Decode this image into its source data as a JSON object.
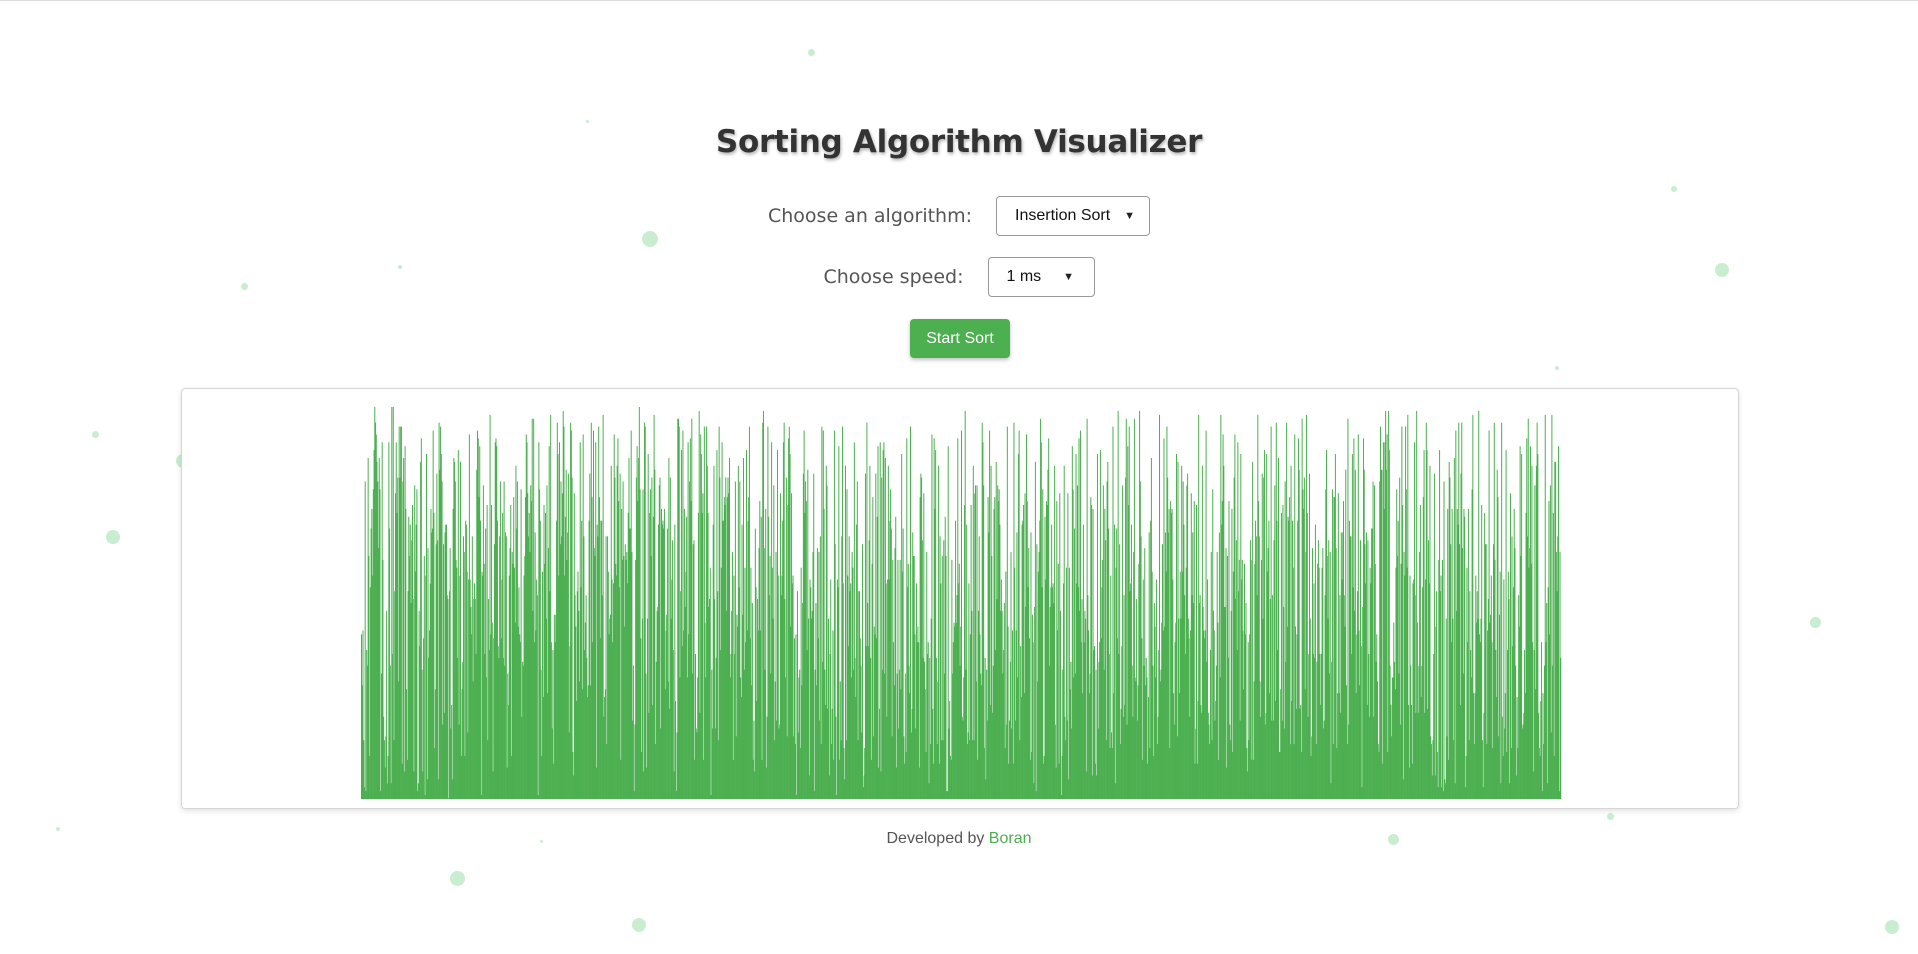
{
  "page": {
    "title": "Sorting Algorithm Visualizer",
    "algorithm_label": "Choose an algorithm:",
    "algorithm_selected": "Insertion Sort",
    "speed_label": "Choose speed:",
    "speed_selected": "1 ms",
    "start_button": "Start Sort",
    "footer_prefix": "Developed by",
    "footer_author": "Boran"
  },
  "colors": {
    "accent": "#4caf50",
    "bar": "#4caf50",
    "dot": "#c9edcf"
  },
  "chart_data": {
    "type": "bar",
    "ylim": [
      0,
      100
    ],
    "values": [
      42,
      29,
      43,
      15,
      3,
      81,
      2,
      38,
      34,
      87,
      62,
      11,
      54,
      69,
      74,
      57,
      79,
      89,
      100,
      96,
      93,
      86,
      81,
      64,
      87,
      79,
      2,
      32,
      91,
      61,
      21,
      15,
      8,
      16,
      48,
      4,
      11,
      91,
      69,
      34,
      4,
      100,
      37,
      100,
      15,
      53,
      78,
      91,
      73,
      82,
      30,
      95,
      82,
      95,
      95,
      9,
      81,
      87,
      7,
      90,
      74,
      28,
      10,
      53,
      72,
      62,
      70,
      50,
      66,
      75,
      51,
      7,
      80,
      58,
      70,
      79,
      2,
      4,
      48,
      39,
      86,
      92,
      33,
      7,
      41,
      62,
      1,
      57,
      88,
      5,
      64,
      36,
      43,
      55,
      74,
      68,
      69,
      94,
      73,
      13,
      28,
      65,
      83,
      66,
      5,
      96,
      84,
      95,
      88,
      81,
      19,
      65,
      22,
      68,
      70,
      70,
      52,
      51,
      0,
      53,
      64,
      18,
      24,
      5,
      74,
      87,
      86,
      81,
      61,
      59,
      36,
      89,
      19,
      57,
      86,
      11,
      28,
      35,
      67,
      63,
      11,
      71,
      70,
      58,
      17,
      56,
      93,
      56,
      49,
      42,
      67,
      30,
      51,
      55,
      51,
      37,
      84,
      94,
      92,
      77,
      90,
      71,
      1,
      58,
      57,
      80,
      60,
      37,
      69,
      31,
      75,
      15,
      51,
      38,
      98,
      42,
      75,
      45,
      7,
      41,
      65,
      91,
      92,
      90,
      71,
      39,
      36,
      67,
      81,
      41,
      56,
      73,
      36,
      81,
      34,
      68,
      67,
      8,
      32,
      24,
      57,
      64,
      75,
      11,
      63,
      60,
      77,
      59,
      45,
      85,
      69,
      81,
      44,
      54,
      42,
      40,
      79,
      21,
      35,
      34,
      57,
      62,
      77,
      93,
      91,
      78,
      67,
      73,
      63,
      80,
      76,
      97,
      48,
      97,
      40,
      68,
      43,
      56,
      52,
      1,
      91,
      79,
      71,
      33,
      11,
      58,
      26,
      75,
      60,
      73,
      46,
      80,
      27,
      64,
      90,
      53,
      98,
      40,
      18,
      38,
      9,
      47,
      40,
      47,
      71,
      96,
      88,
      57,
      91,
      65,
      81,
      67,
      78,
      99,
      95,
      57,
      72,
      84,
      61,
      68,
      83,
      17,
      39,
      96,
      94,
      82,
      12,
      6,
      78,
      52,
      44,
      25,
      53,
      58,
      48,
      30,
      91,
      54,
      71,
      28,
      93,
      67,
      38,
      45,
      52,
      36,
      26,
      29,
      71,
      83,
      29,
      96,
      77,
      40,
      94,
      64,
      62,
      91,
      8,
      70,
      67,
      95,
      77,
      41,
      71,
      71,
      52,
      98,
      21,
      26,
      28,
      67,
      14,
      67,
      58,
      42,
      46,
      47,
      85,
      56,
      40,
      55,
      93,
      82,
      60,
      57,
      85,
      92,
      76,
      54,
      83,
      10,
      74,
      61,
      81,
      62,
      44,
      65,
      61,
      63,
      55,
      73,
      87,
      69,
      69,
      94,
      63,
      20,
      34,
      2,
      19,
      61,
      82,
      90,
      76,
      87,
      100,
      79,
      41,
      12,
      46,
      79,
      7,
      96,
      95,
      32,
      8,
      46,
      88,
      22,
      73,
      79,
      62,
      82,
      24,
      72,
      98,
      84,
      14,
      35,
      48,
      49,
      70,
      80,
      82,
      18,
      74,
      70,
      71,
      69,
      74,
      28,
      43,
      47,
      69,
      30,
      87,
      23,
      82,
      46,
      56,
      66,
      38,
      7,
      70,
      25,
      2,
      17,
      97,
      97,
      95,
      31,
      53,
      89,
      39,
      94,
      43,
      74,
      49,
      58,
      72,
      31,
      91,
      42,
      81,
      92,
      76,
      97,
      32,
      65,
      66,
      10,
      37,
      18,
      17,
      31,
      73,
      99,
      22,
      93,
      88,
      73,
      78,
      10,
      95,
      45,
      31,
      95,
      85,
      73,
      49,
      51,
      59,
      1,
      33,
      18,
      70,
      85,
      51,
      18,
      36,
      89,
      53,
      15,
      95,
      82,
      38,
      59,
      91,
      71,
      71,
      77,
      75,
      82,
      48,
      77,
      82,
      78,
      87,
      31,
      37,
      48,
      63,
      10,
      57,
      37,
      81,
      16,
      47,
      44,
      85,
      54,
      81,
      31,
      26,
      70,
      47,
      87,
      33,
      59,
      40,
      89,
      43,
      71,
      77,
      95,
      41,
      59,
      29,
      50,
      10,
      20,
      7,
      69,
      54,
      25,
      51,
      43,
      64,
      76,
      43,
      72,
      10,
      96,
      99,
      64,
      33,
      74,
      8,
      21,
      95,
      72,
      52,
      62,
      32,
      91,
      59,
      46,
      80,
      15,
      30,
      63,
      20,
      89,
      57,
      18,
      19,
      78,
      52,
      57,
      71,
      91,
      96,
      51,
      31,
      82,
      16,
      75,
      92,
      95,
      88,
      44,
      78,
      55,
      57,
      16,
      41,
      14,
      42,
      1,
      53,
      17,
      31,
      33,
      13,
      59,
      29,
      50,
      83,
      94,
      73,
      81,
      76,
      38,
      84,
      46,
      6,
      56,
      54,
      46,
      48,
      63,
      83,
      2,
      33,
      50,
      29,
      64,
      41,
      63,
      20,
      67,
      14,
      95,
      35,
      94,
      74,
      33,
      24,
      85,
      80,
      23,
      46,
      6,
      37,
      56,
      14,
      23,
      43,
      10,
      94,
      65,
      21,
      1,
      56,
      54,
      90,
      10,
      30,
      15,
      67,
      95,
      55,
      13,
      5,
      85,
      15,
      79,
      57,
      39,
      67,
      53,
      55,
      31,
      63,
      59,
      33,
      91,
      36,
      26,
      70,
      81,
      15,
      53,
      53,
      41,
      34,
      17,
      65,
      3,
      6,
      13,
      83,
      39,
      96,
      50,
      39,
      66,
      85,
      36,
      10,
      60,
      77,
      16,
      44,
      42,
      83,
      41,
      72,
      90,
      8,
      23,
      91,
      7,
      82,
      33,
      89,
      91,
      32,
      87,
      55,
      21,
      56,
      85,
      56,
      71,
      79,
      69,
      16,
      61,
      40,
      29,
      64,
      72,
      8,
      32,
      61,
      18,
      33,
      61,
      28,
      88,
      58,
      69,
      16,
      9,
      32,
      12,
      92,
      54,
      60,
      34,
      27,
      95,
      17,
      23,
      68,
      62,
      62,
      42,
      18,
      55,
      40,
      44,
      40,
      8,
      77,
      83,
      82,
      66,
      36,
      78,
      35,
      28,
      12,
      63,
      37,
      40,
      4,
      36,
      14,
      46,
      93,
      23,
      9,
      92,
      74,
      89,
      36,
      14,
      30,
      85,
      9,
      67,
      55,
      15,
      62,
      15,
      66,
      32,
      72,
      62,
      2,
      2,
      90,
      18,
      25,
      11,
      10,
      61,
      32,
      40,
      45,
      44,
      71,
      45,
      52,
      92,
      55,
      60,
      34,
      44,
      94,
      21,
      20,
      31,
      75,
      99,
      33,
      70,
      14,
      17,
      55,
      15,
      42,
      75,
      48,
      15,
      85,
      15,
      78,
      80,
      30,
      80,
      10,
      48,
      67,
      42,
      32,
      29,
      96,
      91,
      80,
      13,
      36,
      5,
      33,
      20,
      77,
      68,
      94,
      24,
      85,
      62,
      22,
      34,
      74,
      77,
      38,
      86,
      51,
      80,
      76,
      79,
      70,
      48,
      56,
      48,
      32,
      38,
      50,
      13,
      58,
      19,
      95,
      44,
      9,
      20,
      35,
      63,
      18,
      43,
      9,
      96,
      59,
      20,
      43,
      68,
      31,
      88,
      94,
      15,
      39,
      26,
      70,
      71,
      75,
      27,
      78,
      49,
      93,
      76,
      54,
      64,
      41,
      10,
      68,
      12,
      47,
      40,
      4,
      49,
      86,
      2,
      65,
      30,
      58,
      63,
      71,
      97,
      91,
      54,
      79,
      9,
      11,
      72,
      56,
      76,
      75,
      84,
      92,
      34,
      49,
      54,
      70,
      54,
      55,
      50,
      85,
      19,
      8,
      76,
      43,
      60,
      9,
      78,
      48,
      1,
      11,
      33,
      55,
      85,
      21,
      15,
      59,
      20,
      78,
      5,
      59,
      28,
      35,
      18,
      90,
      79,
      31,
      69,
      32,
      88,
      55,
      80,
      54,
      92,
      48,
      94,
      40,
      51,
      27,
      70,
      40,
      48,
      46,
      7,
      97,
      52,
      43,
      27,
      32,
      77,
      75,
      6,
      74,
      38,
      39,
      9,
      33,
      6,
      88,
      18,
      35,
      40,
      89,
      41,
      54,
      61,
      80,
      33,
      74,
      66,
      15,
      81,
      86,
      69,
      37,
      13,
      57,
      17,
      13,
      95,
      27,
      70,
      4,
      59,
      69,
      41,
      99,
      37,
      65,
      14,
      23,
      39,
      80,
      21,
      52,
      24,
      82,
      97,
      19,
      90,
      75,
      95,
      53,
      55,
      70,
      34,
      21,
      63,
      97,
      31,
      30,
      51,
      20,
      29,
      60,
      99,
      81,
      67,
      41,
      10,
      56,
      34,
      64,
      29,
      36,
      31,
      9,
      26,
      68,
      13,
      71,
      87,
      58,
      34,
      11,
      50,
      44,
      31,
      56,
      14,
      21,
      38,
      98,
      30,
      33,
      45,
      65,
      43,
      92,
      44,
      68,
      58,
      95,
      82,
      68,
      74,
      13,
      76,
      73,
      74,
      56,
      27,
      19,
      40,
      45,
      88,
      16,
      86,
      46,
      27,
      58,
      46,
      85,
      58,
      81,
      70,
      52,
      37,
      59,
      80,
      83,
      46,
      41,
      21,
      43,
      78,
      52,
      68,
      50,
      76,
      9,
      18,
      75,
      9,
      25,
      98,
      50,
      52,
      24,
      22,
      85,
      49,
      43,
      41,
      43,
      94,
      35,
      56,
      22,
      19,
      14,
      38,
      63,
      15,
      79,
      48,
      43,
      20,
      25,
      34,
      63,
      45,
      10,
      68,
      31,
      98,
      70,
      76,
      93,
      85,
      49,
      49,
      64,
      8,
      62,
      36,
      76,
      19,
      15,
      48,
      74,
      12,
      58,
      82,
      93,
      51,
      66,
      38,
      91,
      53,
      61,
      20,
      88,
      56,
      61,
      43,
      28,
      60,
      42,
      50,
      13,
      7,
      40,
      15,
      42,
      66,
      61,
      10,
      86,
      10,
      30,
      60,
      71,
      67,
      52,
      98,
      76,
      67,
      30,
      21,
      61,
      83,
      46,
      82,
      89,
      19,
      22,
      88,
      58,
      64,
      71,
      27,
      51,
      95,
      20,
      52,
      20,
      66,
      80,
      25,
      96,
      71,
      38,
      87,
      12,
      12,
      28,
      73,
      20,
      75,
      49,
      18,
      81,
      35,
      96,
      44,
      72,
      71,
      77,
      14,
      85,
      25,
      71,
      59,
      14,
      93,
      44,
      23,
      42,
      71,
      92,
      84,
      23,
      24,
      12,
      97,
      79,
      74,
      82,
      28,
      63,
      98,
      73,
      21,
      37,
      83,
      46,
      11,
      16,
      64,
      37,
      55,
      36,
      70,
      14,
      35,
      60,
      66,
      59,
      37,
      24,
      37,
      59,
      64,
      18,
      20,
      52,
      79,
      89,
      62,
      46,
      66,
      32,
      63,
      4,
      35,
      79,
      14,
      77,
      77,
      88,
      64,
      13,
      27,
      78,
      27,
      52,
      22,
      68,
      56,
      68,
      76,
      52,
      44,
      84,
      29,
      14,
      97,
      19,
      71,
      67,
      67,
      37,
      88,
      54,
      92,
      48,
      84,
      27,
      42,
      53,
      93,
      43,
      29,
      66,
      39,
      3,
      49,
      92,
      84,
      65,
      55,
      68,
      24,
      66,
      37,
      21,
      59,
      55,
      69,
      69,
      81,
      21,
      80,
      60,
      35,
      42,
      30,
      14,
      12,
      81,
      95,
      84,
      84,
      9,
      91,
      74,
      91,
      99,
      84,
      93,
      12,
      99,
      89,
      34,
      24,
      16,
      31,
      31,
      45,
      35,
      28,
      59,
      79,
      62,
      71,
      32,
      82,
      19,
      60,
      95,
      75,
      5,
      63,
      57,
      95,
      79,
      59,
      98,
      24,
      8,
      57,
      34,
      24,
      9,
      55,
      56,
      91,
      52,
      22,
      99,
      45,
      22,
      34,
      63,
      75,
      26,
      34,
      54,
      77,
      89,
      22,
      56,
      96,
      89,
      23,
      66,
      55,
      85,
      16,
      14,
      6,
      15,
      37,
      83,
      6,
      44,
      53,
      12,
      3,
      61,
      89,
      53,
      57,
      3,
      61,
      2,
      81,
      5,
      4,
      46,
      16,
      74,
      10,
      86,
      82,
      65,
      40,
      74,
      46,
      15,
      87,
      4,
      94,
      48,
      74,
      70,
      96,
      65,
      24,
      83,
      96,
      64,
      32,
      74,
      72,
      3,
      11,
      59,
      40,
      74,
      15,
      53,
      38,
      31,
      79,
      98,
      27,
      14,
      27,
      57,
      45,
      53,
      46,
      99,
      42,
      40,
      46,
      75,
      15,
      3,
      22,
      73,
      65,
      65,
      14,
      43,
      51,
      94,
      45,
      47,
      57,
      40,
      13,
      65,
      96,
      61,
      38,
      26,
      84,
      77,
      16,
      47,
      58,
      4,
      96,
      21,
      11,
      56,
      18,
      27,
      89,
      12,
      38,
      58,
      51,
      4,
      78,
      13,
      67,
      39,
      54,
      74,
      64,
      34,
      6,
      26,
      13,
      52,
      44,
      90,
      62,
      88,
      18,
      19,
      22,
      38,
      27,
      73,
      92,
      67,
      97,
      59,
      64,
      90,
      60,
      85,
      40,
      7,
      38,
      80,
      28,
      85,
      96,
      88,
      22,
      13,
      11,
      25,
      40,
      2,
      27,
      14,
      34,
      98,
      40,
      50,
      4,
      54,
      76,
      42,
      80,
      17,
      98,
      34,
      73,
      11,
      86,
      86,
      63,
      53,
      67,
      90,
      2,
      63,
      36
    ]
  }
}
